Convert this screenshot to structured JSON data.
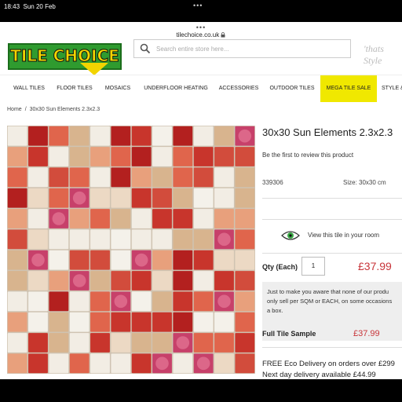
{
  "status_bar": {
    "time": "18:43",
    "date": "Sun 20 Feb",
    "dots": "•••"
  },
  "browser": {
    "menu_dots": "•••",
    "url": "tilechoice.co.uk"
  },
  "header": {
    "logo_text": "TILE CHOICE",
    "search_placeholder": "Search entire store here...",
    "tagline": "'thats Style"
  },
  "nav": [
    {
      "label": "WALL TILES"
    },
    {
      "label": "FLOOR TILES"
    },
    {
      "label": "MOSAICS"
    },
    {
      "label": "UNDERFLOOR HEATING"
    },
    {
      "label": "ACCESSORIES"
    },
    {
      "label": "OUTDOOR TILES"
    },
    {
      "label": "MEGA TILE SALE"
    },
    {
      "label": "STYLE &"
    }
  ],
  "breadcrumb": {
    "home": "Home",
    "separator": "/",
    "current": "30x30 Sun Elements 2.3x2.3"
  },
  "product": {
    "title": "30x30 Sun Elements 2.3x2.3",
    "review_link": "Be the first to review this product",
    "sku": "339306",
    "size": "Size: 30x30 cm",
    "view_in_room": "View this tile in your room",
    "qty_label": "Qty (Each)",
    "qty_value": "1",
    "price": "£37.99",
    "notice_lines": [
      "Just to make you aware that none of our produ",
      "only sell per SQM or EACH, on some occasions",
      "a box."
    ],
    "sample_label": "Full Tile Sample",
    "sample_price": "£37.99",
    "free_delivery": "FREE Eco Delivery on orders over £299",
    "next_day": "Next day delivery available £44.99"
  },
  "colors": {
    "brand_green": "#2f9b2f",
    "brand_yellow": "#f4d600",
    "price_red": "#c8353a",
    "mega_sale_bg": "#f0e800"
  }
}
